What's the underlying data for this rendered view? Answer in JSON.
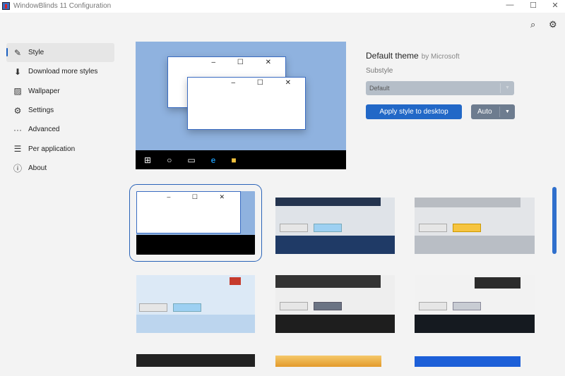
{
  "window": {
    "title": "WindowBlinds 11 Configuration",
    "minimize": "—",
    "maximize": "☐",
    "close": "✕"
  },
  "toolbar": {
    "search_icon": "⌕",
    "settings_icon": "⚙"
  },
  "sidebar": {
    "items": [
      {
        "label": "Style",
        "icon": "✎"
      },
      {
        "label": "Download more styles",
        "icon": "⬇"
      },
      {
        "label": "Wallpaper",
        "icon": "▨"
      },
      {
        "label": "Settings",
        "icon": "⚙"
      },
      {
        "label": "Advanced",
        "icon": "···"
      },
      {
        "label": "Per application",
        "icon": "☰"
      },
      {
        "label": "About",
        "icon": "ⓘ"
      }
    ]
  },
  "preview": {
    "window_controls": "– ☐ ✕"
  },
  "theme": {
    "name": "Default theme",
    "author": "by Microsoft",
    "substyle_label": "Substyle",
    "substyle_value": "Default",
    "apply_label": "Apply style to desktop",
    "auto_label": "Auto"
  },
  "colors": {
    "accent": "#2268c7",
    "preview_bg": "#8fb2df"
  }
}
